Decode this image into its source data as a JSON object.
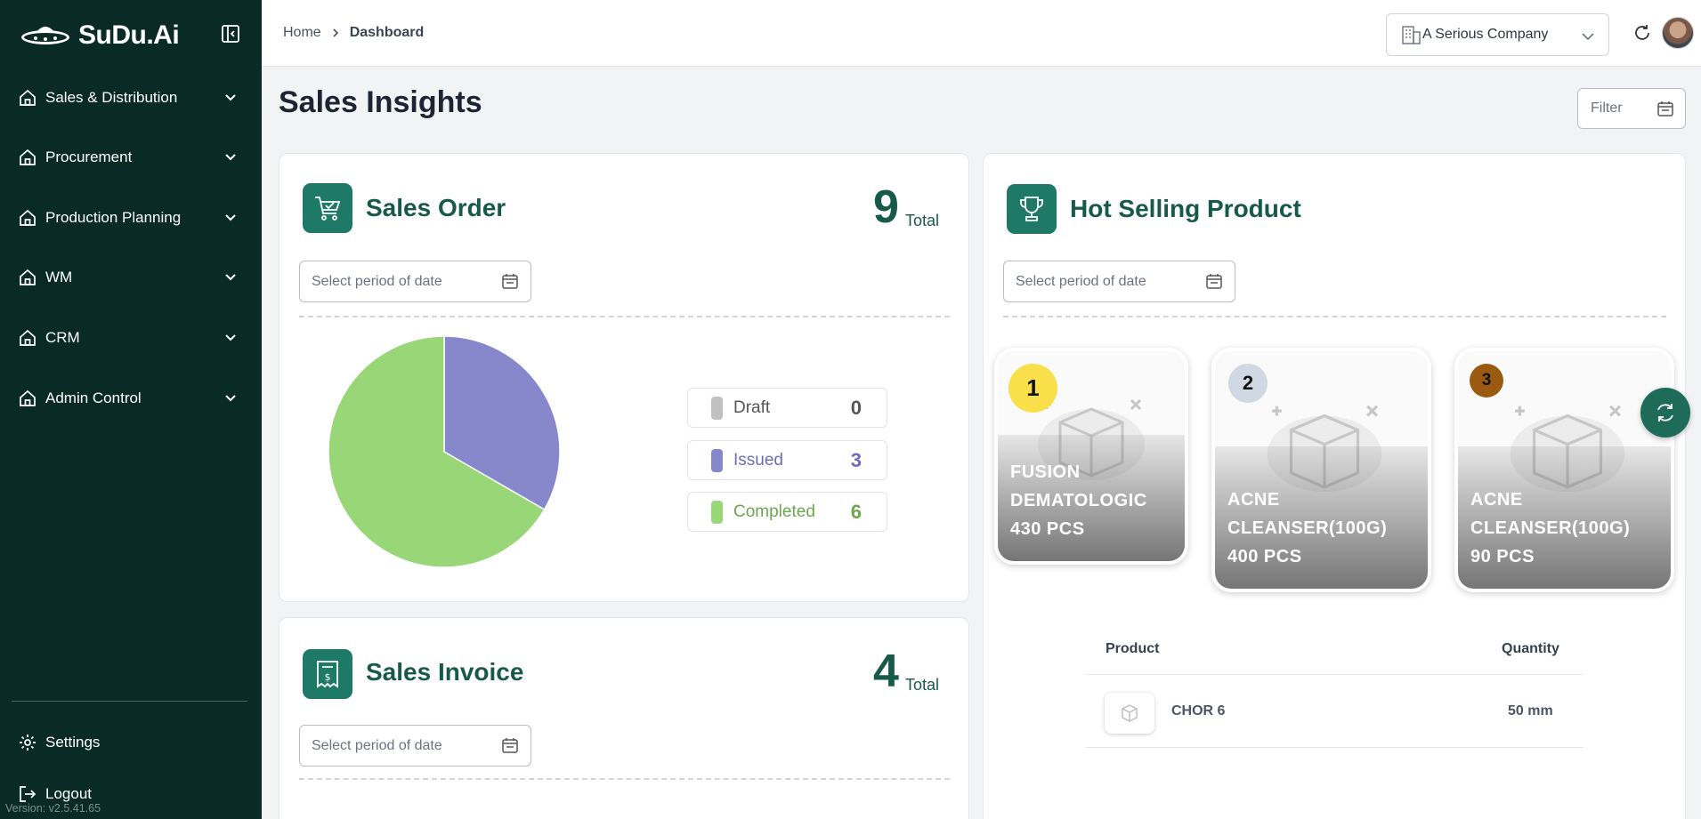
{
  "brand": {
    "name": "SuDu.Ai"
  },
  "sidebar": {
    "items": [
      {
        "label": "Sales & Distribution"
      },
      {
        "label": "Procurement"
      },
      {
        "label": "Production Planning"
      },
      {
        "label": "WM"
      },
      {
        "label": "CRM"
      },
      {
        "label": "Admin Control"
      }
    ],
    "settings_label": "Settings",
    "logout_label": "Logout",
    "version": "Version: v2.5.41.65"
  },
  "header": {
    "breadcrumb_home": "Home",
    "breadcrumb_current": "Dashboard",
    "company": "A Serious Company"
  },
  "main": {
    "title": "Sales Insights",
    "filter_placeholder": "Filter"
  },
  "sales_order": {
    "title": "Sales Order",
    "total": "9",
    "total_label": "Total",
    "date_placeholder": "Select period of date",
    "legend": [
      {
        "label": "Draft",
        "count": "0",
        "color": "#c0c0c0"
      },
      {
        "label": "Issued",
        "count": "3",
        "color": "#8787cc"
      },
      {
        "label": "Completed",
        "count": "6",
        "color": "#98d677"
      }
    ]
  },
  "chart_data": {
    "type": "pie",
    "categories": [
      "Draft",
      "Issued",
      "Completed"
    ],
    "values": [
      0,
      3,
      6
    ],
    "colors": [
      "#c0c0c0",
      "#8787cc",
      "#98d677"
    ]
  },
  "sales_invoice": {
    "title": "Sales Invoice",
    "total": "4",
    "total_label": "Total",
    "date_placeholder": "Select period of date"
  },
  "hot_selling": {
    "title": "Hot Selling Product",
    "date_placeholder": "Select period of date",
    "products": [
      {
        "rank": "1",
        "line1": "FUSION",
        "line2": "DEMATOLOGIC",
        "line3": "430 PCS",
        "rank_color": "#f9e04b"
      },
      {
        "rank": "2",
        "line1": "ACNE",
        "line2": "CLEANSER(100G)",
        "line3": "400 PCS",
        "rank_color": "#cfd8e3"
      },
      {
        "rank": "3",
        "line1": "ACNE",
        "line2": "CLEANSER(100G)",
        "line3": "90 PCS",
        "rank_color": "#9a5a10"
      }
    ],
    "table": {
      "col_product": "Product",
      "col_quantity": "Quantity",
      "rows": [
        {
          "product": "CHOR 6",
          "quantity": "50 mm"
        }
      ]
    }
  }
}
